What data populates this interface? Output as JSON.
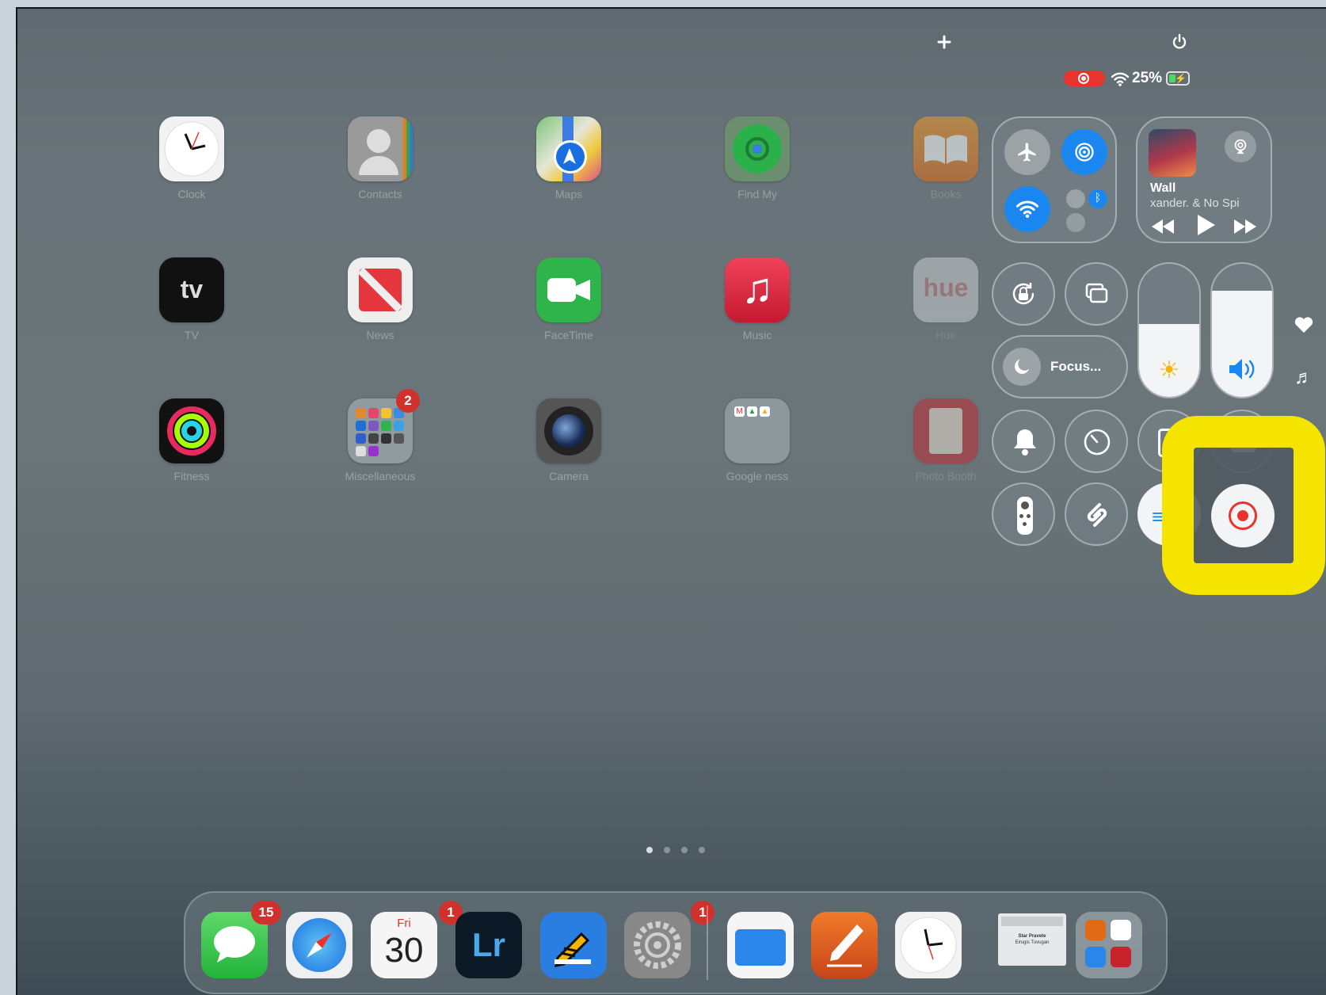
{
  "status_bar": {
    "battery": "25%",
    "recording_indicator": "record-icon"
  },
  "top_controls": {
    "add": "plus-icon",
    "power": "power-icon"
  },
  "apps": [
    {
      "label": "Clock",
      "icon": "clock-icon"
    },
    {
      "label": "Contacts",
      "icon": "contacts-icon"
    },
    {
      "label": "Maps",
      "icon": "maps-icon"
    },
    {
      "label": "Find My",
      "icon": "find-my-icon"
    },
    {
      "label": "Books",
      "icon": "books-icon"
    },
    {
      "label": "TV",
      "icon": "tv-icon"
    },
    {
      "label": "News",
      "icon": "news-icon"
    },
    {
      "label": "FaceTime",
      "icon": "facetime-icon"
    },
    {
      "label": "Music",
      "icon": "music-icon"
    },
    {
      "label": "Hue",
      "icon": "hue-icon"
    },
    {
      "label": "Fitness",
      "icon": "fitness-icon"
    },
    {
      "label": "Miscellaneous",
      "icon": "folder-icon",
      "badge": "2"
    },
    {
      "label": "Camera",
      "icon": "camera-icon"
    },
    {
      "label": "Google ness",
      "icon": "folder-icon"
    },
    {
      "label": "Photo Booth",
      "icon": "photo-booth-icon"
    }
  ],
  "control_center": {
    "now_playing": {
      "title": "Wall",
      "artist": "xander. & No Spi"
    },
    "focus_label": "Focus...",
    "brightness_level": 0.55,
    "volume_level": 0.8
  },
  "side_icons": [
    "heart-icon",
    "music-note-icon"
  ],
  "page_dots": {
    "count": 4,
    "active": 0
  },
  "dock": [
    {
      "name": "messages",
      "badge": "15"
    },
    {
      "name": "safari"
    },
    {
      "name": "calendar",
      "day": "Fri",
      "date": "30",
      "badge": "1"
    },
    {
      "name": "lightroom",
      "text": "Lr"
    },
    {
      "name": "notes-app"
    },
    {
      "name": "settings",
      "badge": "1"
    },
    {
      "name": "files"
    },
    {
      "name": "pages"
    },
    {
      "name": "clock"
    },
    {
      "name": "document-preview",
      "text_line1": "Star Pravete",
      "text_line2": "Eirugis Tuvugan"
    },
    {
      "name": "app-library"
    }
  ],
  "colors": {
    "accent_blue": "#1a86f0",
    "highlight_yellow": "#f5e400",
    "record_red": "#e8332f",
    "badge_red": "#d0312d"
  }
}
